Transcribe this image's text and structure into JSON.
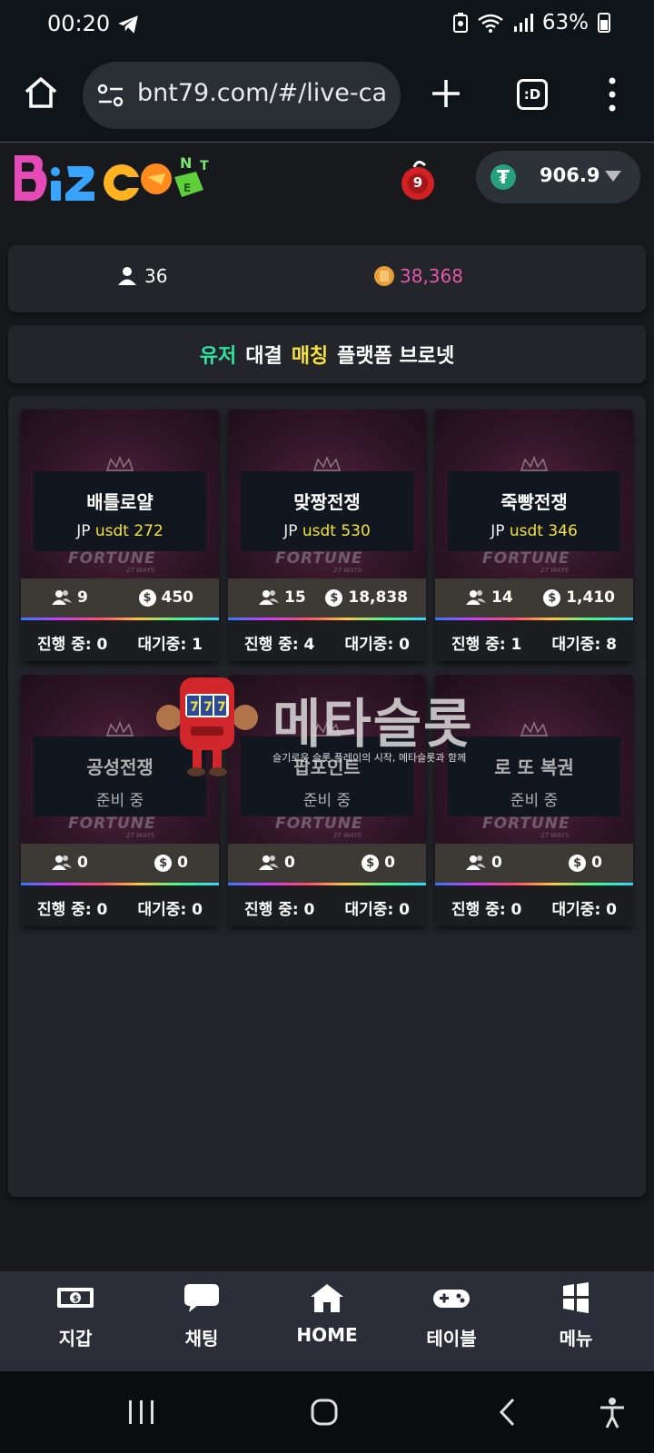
{
  "status_bar": {
    "time": "00:20",
    "battery": "63%"
  },
  "browser": {
    "url": "bnt79.com/#/live-ca"
  },
  "header": {
    "balance": "906.9"
  },
  "notification_count": "9",
  "stats": {
    "users": "36",
    "coins": "38,368"
  },
  "banner": {
    "word1": "유저",
    "word2": "대결",
    "word3": "매칭",
    "word4": "플랫폼 브로넷",
    "color1": "#2ee6a1",
    "color3": "#f4e23c"
  },
  "cards": [
    {
      "title": "배틀로얄",
      "jp_prefix": "JP",
      "jp_value": "usdt 272",
      "players": "9",
      "pot": "450",
      "running": "진행 중: 0",
      "waiting": "대기중: 1"
    },
    {
      "title": "맞짱전쟁",
      "jp_prefix": "JP",
      "jp_value": "usdt 530",
      "players": "15",
      "pot": "18,838",
      "running": "진행 중: 4",
      "waiting": "대기중: 0"
    },
    {
      "title": "죽빵전쟁",
      "jp_prefix": "JP",
      "jp_value": "usdt 346",
      "players": "14",
      "pot": "1,410",
      "running": "진행 중: 1",
      "waiting": "대기중: 8"
    },
    {
      "title": "공성전쟁",
      "subtitle": "준비 중",
      "players": "0",
      "pot": "0",
      "running": "진행 중: 0",
      "waiting": "대기중: 0"
    },
    {
      "title": "팝포인트",
      "subtitle": "준비 중",
      "players": "0",
      "pot": "0",
      "running": "진행 중: 0",
      "waiting": "대기중: 0"
    },
    {
      "title": "로 또 복권",
      "subtitle": "준비 중",
      "players": "0",
      "pot": "0",
      "running": "진행 중: 0",
      "waiting": "대기중: 0"
    }
  ],
  "card_art": {
    "fortune": "FORTUNE",
    "ways": "27 WAYS"
  },
  "watermark": {
    "title": "메타슬롯",
    "subtitle": "슬기로운 슬롯 플레이의 시작, 메타슬롯과 함께"
  },
  "bottom_nav": [
    {
      "label": "지갑",
      "icon": "wallet-icon"
    },
    {
      "label": "채팅",
      "icon": "chat-icon"
    },
    {
      "label": "HOME",
      "icon": "home-icon"
    },
    {
      "label": "테이블",
      "icon": "gamepad-icon"
    },
    {
      "label": "메뉴",
      "icon": "menu-grid-icon"
    }
  ]
}
